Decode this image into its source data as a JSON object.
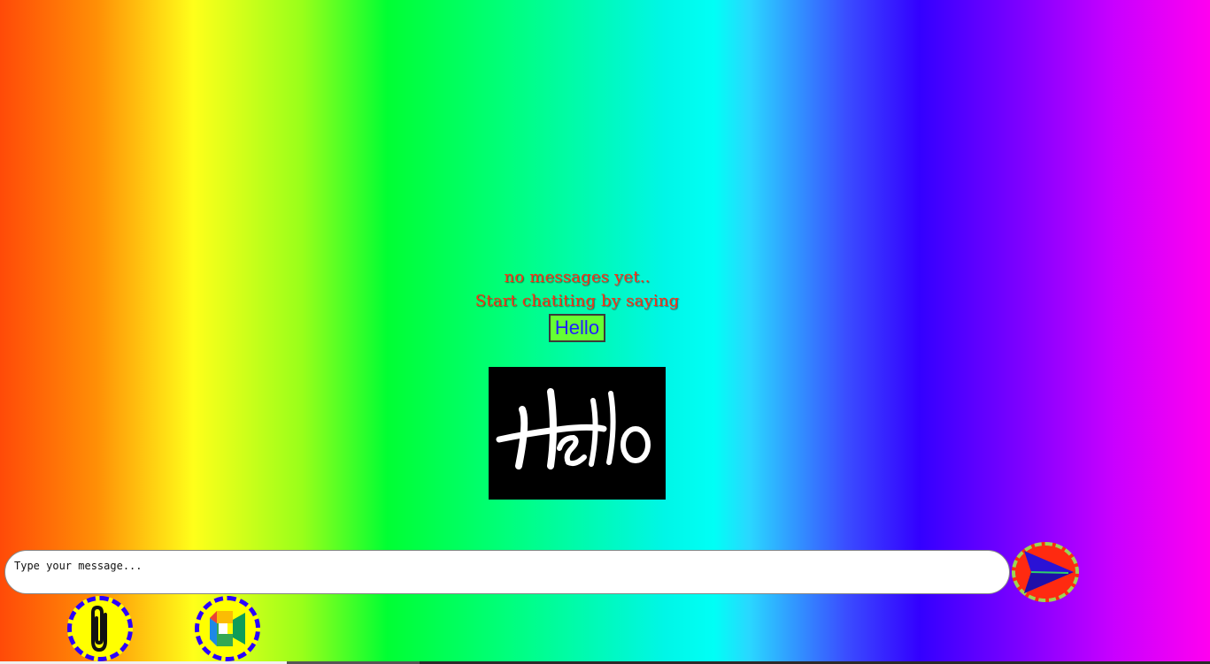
{
  "empty_state": {
    "line1": "no messages yet..",
    "line2": "Start chatiting by saying",
    "hello_button_label": "Hello"
  },
  "hello_image": {
    "text": "Hello",
    "alt": "Hello greeting image"
  },
  "composer": {
    "placeholder": "Type your message...",
    "send_icon": "send-arrow-icon"
  },
  "actions": {
    "attach_icon": "paperclip-icon",
    "meet_icon": "video-meet-icon"
  },
  "colors": {
    "empty_text": "#ff2f15",
    "hello_button_bg": "#66ff33",
    "hello_button_text": "#2020ff",
    "send_bg": "#ff2a10",
    "send_border": "#9cd653",
    "action_bg": "#ffff00",
    "action_border": "#2a00ff"
  }
}
